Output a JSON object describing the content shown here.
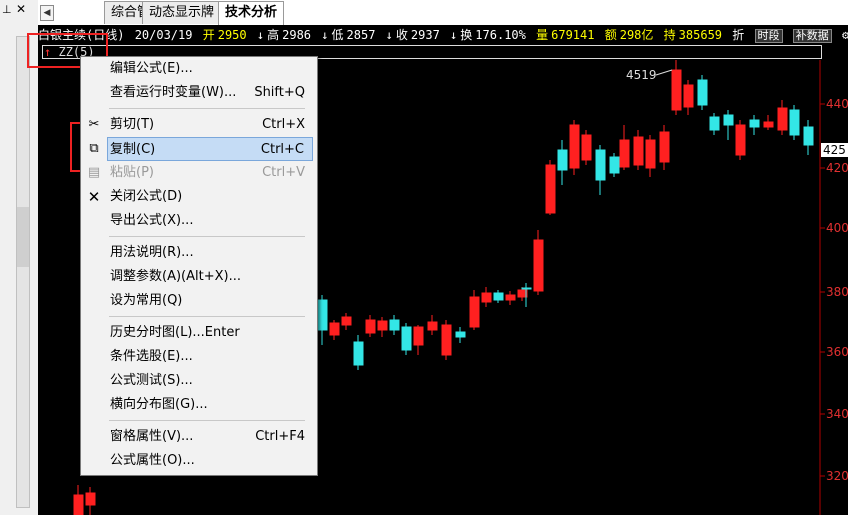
{
  "tabs": [
    "综合管理",
    "动态显示牌",
    "技术分析"
  ],
  "info": {
    "title": "白银主续(日线)",
    "date": "20/03/19",
    "open_label": "开",
    "open": "2950",
    "high_label": "高",
    "high": "2986",
    "low_label": "低",
    "low": "2857",
    "close_label": "收",
    "close": "2937",
    "turnover_label": "换",
    "turnover": "176.10%",
    "volume_label": "量",
    "volume": "679141",
    "amount_label": "额",
    "amount": "298亿",
    "hold_label": "持",
    "hold": "385659",
    "trailing": "折",
    "btn_period": "时段",
    "btn_fill": "补数据",
    "btn_x": "✕"
  },
  "indicator": {
    "name": "ZZ",
    "param": "(5)"
  },
  "chart_data": {
    "type": "candlestick",
    "high_label": "4519",
    "current_price": "425",
    "y_ticks": [
      "440",
      "420",
      "400",
      "380",
      "360",
      "340",
      "320"
    ],
    "colors": {
      "up": "#ff2020",
      "down": "#33e6e6",
      "axis": "#b00000"
    }
  },
  "menu": [
    {
      "label": "编辑公式(E)...",
      "shortcut": "",
      "icon": "",
      "disabled": false,
      "highlighted": false
    },
    {
      "label": "查看运行时变量(W)...",
      "shortcut": "Shift+Q",
      "icon": "",
      "disabled": false,
      "highlighted": false
    },
    {
      "label": "剪切(T)",
      "shortcut": "Ctrl+X",
      "icon": "scissors-icon",
      "disabled": false,
      "highlighted": false
    },
    {
      "label": "复制(C)",
      "shortcut": "Ctrl+C",
      "icon": "copy-icon",
      "disabled": false,
      "highlighted": true
    },
    {
      "label": "粘贴(P)",
      "shortcut": "Ctrl+V",
      "icon": "paste-icon",
      "disabled": true,
      "highlighted": false
    },
    {
      "label": "关闭公式(D)",
      "shortcut": "",
      "icon": "close-icon",
      "disabled": false,
      "highlighted": false
    },
    {
      "label": "导出公式(X)...",
      "shortcut": "",
      "icon": "",
      "disabled": false,
      "highlighted": false
    },
    {
      "label": "用法说明(R)...",
      "shortcut": "",
      "icon": "",
      "disabled": false,
      "highlighted": false
    },
    {
      "label": "调整参数(A)(Alt+X)...",
      "shortcut": "",
      "icon": "",
      "disabled": false,
      "highlighted": false
    },
    {
      "label": "设为常用(Q)",
      "shortcut": "",
      "icon": "",
      "disabled": false,
      "highlighted": false
    },
    {
      "label": "历史分时图(L)...Enter",
      "shortcut": "",
      "icon": "",
      "disabled": false,
      "highlighted": false
    },
    {
      "label": "条件选股(E)...",
      "shortcut": "",
      "icon": "",
      "disabled": false,
      "highlighted": false
    },
    {
      "label": "公式测试(S)...",
      "shortcut": "",
      "icon": "",
      "disabled": false,
      "highlighted": false
    },
    {
      "label": "横向分布图(G)...",
      "shortcut": "",
      "icon": "",
      "disabled": false,
      "highlighted": false
    },
    {
      "label": "窗格属性(V)...",
      "shortcut": "Ctrl+F4",
      "icon": "",
      "disabled": false,
      "highlighted": false
    },
    {
      "label": "公式属性(O)...",
      "shortcut": "",
      "icon": "",
      "disabled": false,
      "highlighted": false
    }
  ]
}
